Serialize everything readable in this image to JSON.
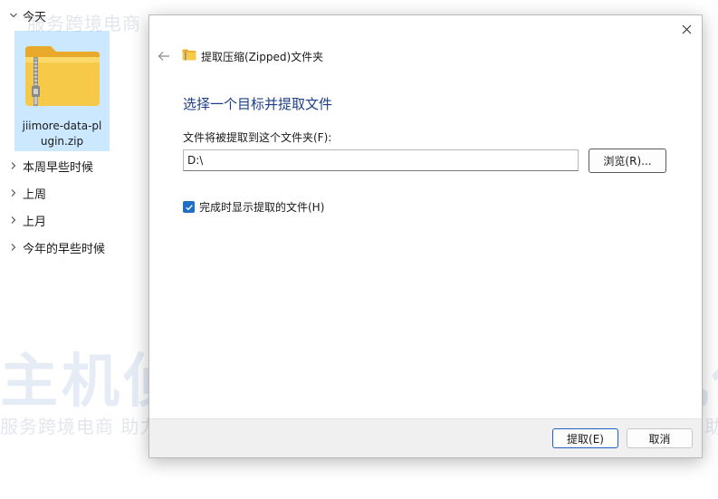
{
  "explorer": {
    "today_group": "今天",
    "file": {
      "name_line1": "jiimore-data-pl",
      "name_line2": "ugin.zip"
    },
    "groups": [
      {
        "label": "本周早些时候"
      },
      {
        "label": "上周"
      },
      {
        "label": "上月"
      },
      {
        "label": "今年的早些时候"
      }
    ]
  },
  "watermark": {
    "slogan": "服务跨境电商  助力中企出海",
    "brand": "主机侦探"
  },
  "dialog": {
    "title": "提取压缩(Zipped)文件夹",
    "heading": "选择一个目标并提取文件",
    "path_label": "文件将被提取到这个文件夹(F):",
    "path_value": "D:\\",
    "browse_label": "浏览(R)...",
    "show_files_label": "完成时显示提取的文件(H)",
    "show_files_checked": true,
    "extract_label": "提取(E)",
    "cancel_label": "取消"
  },
  "colors": {
    "heading": "#1e3f87",
    "checkbox": "#1f6fc5",
    "selection": "#cce8ff",
    "folder": "#f5c242"
  }
}
